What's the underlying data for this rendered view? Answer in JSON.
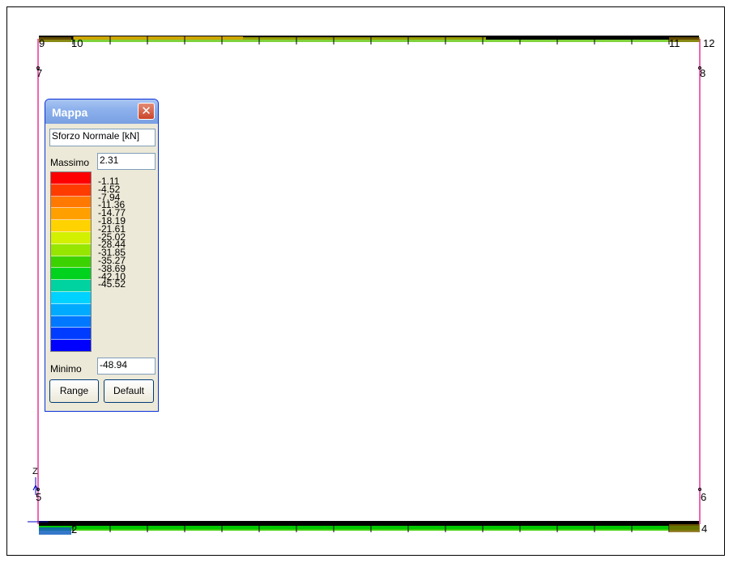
{
  "window": {
    "title": "Mappa",
    "close_glyph": "✕"
  },
  "mappa": {
    "quantity": "Sforzo Normale [kN]",
    "max_label": "Massimo",
    "max_value": "2.31",
    "min_label": "Minimo",
    "min_value": "-48.94",
    "range_button": "Range",
    "default_button": "Default",
    "scale_values": [
      "-1.11",
      "-4.52",
      "-7.94",
      "-11.36",
      "-14.77",
      "-18.19",
      "-21.61",
      "-25.02",
      "-28.44",
      "-31.85",
      "-35.27",
      "-38.69",
      "-42.10",
      "-45.52"
    ],
    "scale_colors": [
      "#ff0000",
      "#ff3c00",
      "#ff7800",
      "#ffa000",
      "#ffd200",
      "#d2f000",
      "#96e600",
      "#3cd200",
      "#00d21e",
      "#00d2a0",
      "#00d2ff",
      "#00aaff",
      "#0078ff",
      "#003cff",
      "#0000ff"
    ]
  },
  "model": {
    "node_labels": {
      "n5": "5",
      "n6": "6",
      "n7": "7",
      "n8": "8",
      "n9": "9",
      "n10": "10",
      "n11": "11",
      "n12": "12",
      "n4": "4",
      "n2": "2",
      "axis_z": "Z"
    },
    "colors": {
      "column": "#e0007a",
      "beam": "#000000",
      "beam_fill_top": "#f0c400",
      "beam_fill_bottom": "#00c800",
      "support": "#0000c8"
    }
  }
}
